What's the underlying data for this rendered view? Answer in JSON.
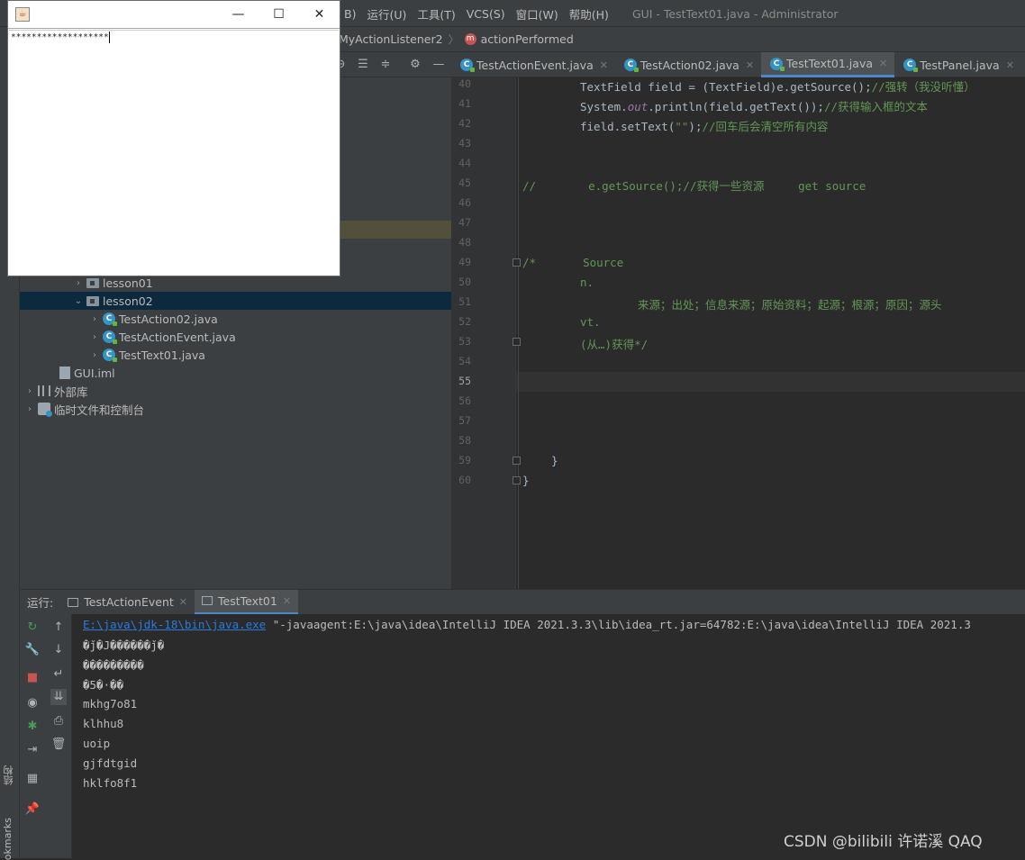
{
  "menu": {
    "items": [
      "B)",
      "运行(U)",
      "工具(T)",
      "VCS(S)",
      "窗口(W)",
      "帮助(H)"
    ],
    "window_title": "GUI - TestText01.java - Administrator"
  },
  "breadcrumb": {
    "class": "MyActionListener2",
    "method": "actionPerformed",
    "method_icon": "m"
  },
  "project_tree": {
    "items": [
      {
        "label": "lesson01",
        "type": "folder",
        "expanded": false
      },
      {
        "label": "lesson02",
        "type": "folder",
        "expanded": true
      },
      {
        "label": "TestAction02.java",
        "type": "class"
      },
      {
        "label": "TestActionEvent.java",
        "type": "class"
      },
      {
        "label": "TestText01.java",
        "type": "class"
      },
      {
        "label": "GUI.iml",
        "type": "iml"
      },
      {
        "label": "外部库",
        "type": "library"
      },
      {
        "label": "临时文件和控制台",
        "type": "scratch"
      }
    ]
  },
  "editor_tabs": [
    {
      "label": "TestActionEvent.java",
      "active": false
    },
    {
      "label": "TestAction02.java",
      "active": false
    },
    {
      "label": "TestText01.java",
      "active": true
    },
    {
      "label": "TestPanel.java",
      "active": false
    }
  ],
  "editor": {
    "line_numbers": [
      "40",
      "41",
      "42",
      "43",
      "44",
      "45",
      "46",
      "47",
      "48",
      "49",
      "50",
      "51",
      "52",
      "53",
      "54",
      "55",
      "56",
      "57",
      "58",
      "59",
      "60"
    ],
    "current_line": "55",
    "lines": {
      "l40a": "TextField field = (TextField)e.getSource();",
      "l40b": "//强转（我没听懂）",
      "l41a": "System.",
      "l41b": "out",
      "l41c": ".println(field.getText());",
      "l41d": "//获得输入框的文本",
      "l42a": "field.setText(",
      "l42b": "\"\"",
      "l42c": ");",
      "l42d": "//回车后会清空所有内容",
      "l45a": "//",
      "l45b": "e.getSource();//获得一些资源     get source",
      "l49a": "/*",
      "l49b": "Source",
      "l50": "n.",
      "l51": "来源；出处；信息来源；原始资料；起源；根源；原因；源头",
      "l52": "vt.",
      "l53": "(从…)获得*/",
      "l59": "}",
      "l60": "}"
    }
  },
  "run_panel": {
    "label": "运行:",
    "tabs": [
      {
        "label": "TestActionEvent",
        "active": false
      },
      {
        "label": "TestText01",
        "active": true
      }
    ],
    "console": {
      "cmd_link": "E:\\java\\jdk-18\\bin\\java.exe",
      "cmd_rest": " \"-javaagent:E:\\java\\idea\\IntelliJ IDEA 2021.3.3\\lib\\idea_rt.jar=64782:E:\\java\\idea\\IntelliJ IDEA 2021.3",
      "lines": [
        "�ǰ�J������ǰ�",
        "���������",
        "�5�·��",
        "mkhg7o81",
        "klhhu8",
        "uoip",
        "gjfdtgid",
        "hklfo8f1"
      ]
    }
  },
  "side_labels": {
    "structure": "结构",
    "bookmarks": "okmarks"
  },
  "watermark": "CSDN @bilibili   许诺溪  QAQ",
  "java_window": {
    "field_value": "*******************",
    "buttons": {
      "minimize": "—",
      "maximize": "☐",
      "close": "✕"
    }
  },
  "colors": {
    "accent": "#4a88c7",
    "class_icon": "#3592c4",
    "stop": "#c75450",
    "run": "#499c54"
  }
}
